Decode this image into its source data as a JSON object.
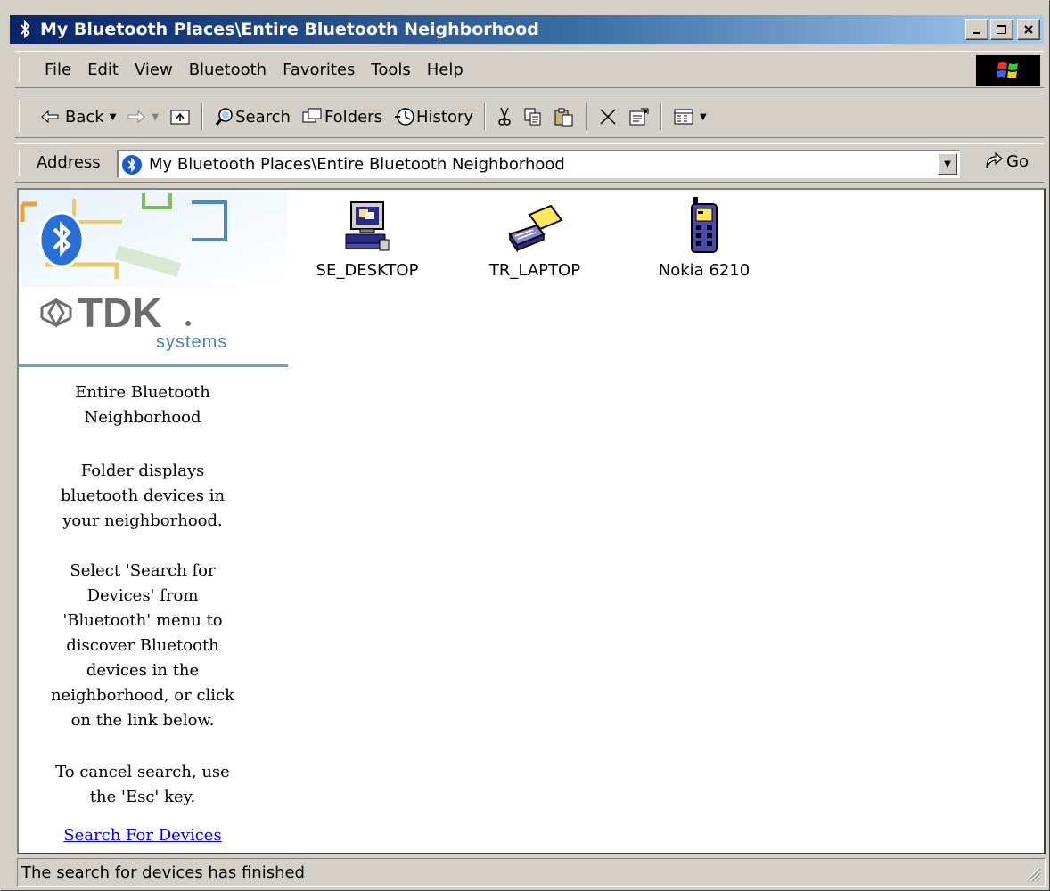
{
  "window": {
    "title": "My Bluetooth Places\\Entire Bluetooth Neighborhood",
    "buttons": [
      "_",
      "□",
      "X"
    ]
  },
  "menu": [
    "File",
    "Edit",
    "View",
    "Bluetooth",
    "Favorites",
    "Tools",
    "Help"
  ],
  "toolbar": {
    "back": "Back",
    "search": "Search",
    "folders": "Folders",
    "history": "History"
  },
  "address": {
    "label": "Address",
    "value": "My Bluetooth Places\\Entire Bluetooth Neighborhood",
    "go": "Go"
  },
  "sidebar": {
    "logo_sub": "systems",
    "heading_line1": "Entire Bluetooth",
    "heading_line2": "Neighborhood",
    "desc_lines": [
      "Folder displays",
      "bluetooth devices in",
      "your neighborhood."
    ],
    "instr_lines": [
      "Select 'Search for",
      "Devices' from",
      "'Bluetooth' menu to",
      "discover Bluetooth",
      "devices in the",
      "neighborhood, or click",
      "on the link below."
    ],
    "cancel_lines": [
      "To cancel search, use",
      "the 'Esc' key."
    ],
    "link": "Search For Devices"
  },
  "devices": [
    {
      "name": "SE_DESKTOP",
      "icon": "desktop-computer-icon"
    },
    {
      "name": "TR_LAPTOP",
      "icon": "laptop-icon"
    },
    {
      "name": "Nokia 6210",
      "icon": "mobile-phone-icon"
    }
  ],
  "status": "The search for devices has finished",
  "colors": {
    "title_start": "#0a246a",
    "title_end": "#a6caf0",
    "link": "#0000ee",
    "bluetooth": "#1c5bd8"
  }
}
